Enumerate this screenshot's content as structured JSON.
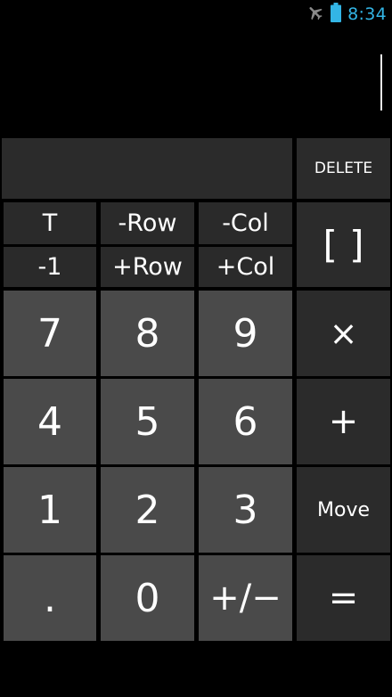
{
  "status_bar": {
    "time": "8:34",
    "icons": [
      "airplane-mode-icon",
      "battery-icon"
    ],
    "accent_color": "#33b5e5"
  },
  "display": {
    "expression": ""
  },
  "matrix_buttons": {
    "transpose": "T",
    "inverse": "-1",
    "remove_row": "-Row",
    "add_row": "+Row",
    "remove_col": "-Col",
    "add_col": "+Col",
    "brackets": "[ ]"
  },
  "controls": {
    "delete": "DELETE",
    "multiply": "×",
    "plus": "+",
    "move": "Move",
    "equals": "="
  },
  "keypad": {
    "seven": "7",
    "eight": "8",
    "nine": "9",
    "four": "4",
    "five": "5",
    "six": "6",
    "one": "1",
    "two": "2",
    "three": "3",
    "decimal": ".",
    "zero": "0",
    "sign": "+/−"
  }
}
